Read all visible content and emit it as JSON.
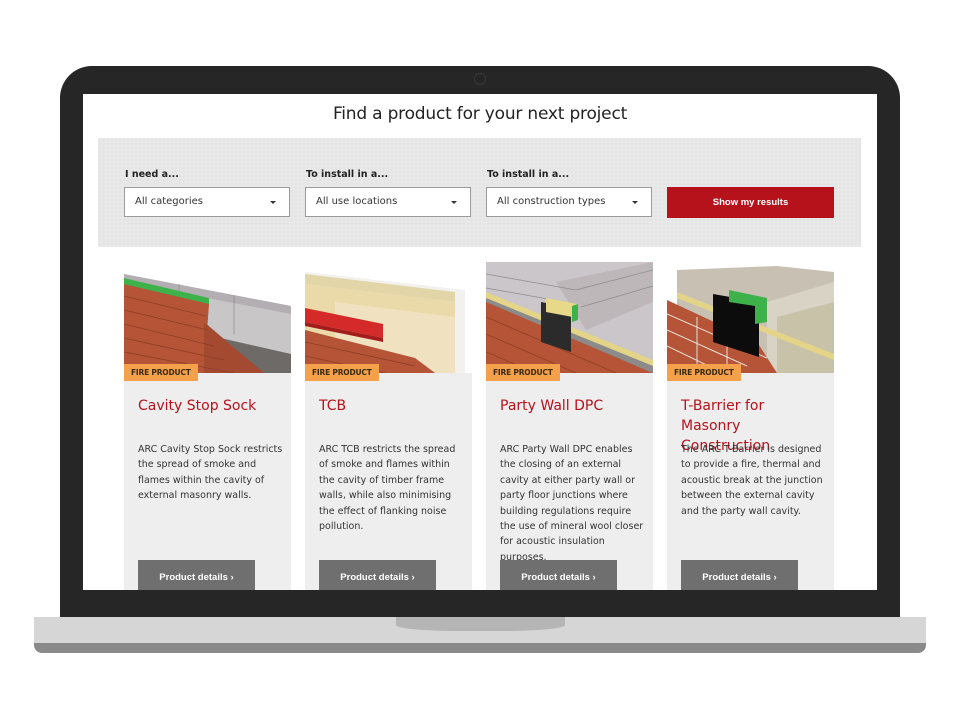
{
  "page": {
    "title": "Find a product for your next project"
  },
  "filters": {
    "category": {
      "label": "I need a...",
      "value": "All categories"
    },
    "location": {
      "label": "To install in a...",
      "value": "All use locations"
    },
    "construction": {
      "label": "To install in a...",
      "value": "All construction types"
    },
    "submit_label": "Show my results"
  },
  "colors": {
    "brand_red": "#b5121b",
    "badge_orange": "#f5a04a",
    "button_grey": "#6f6f6f"
  },
  "products": [
    {
      "badge": "FIRE PRODUCT",
      "title": "Cavity Stop Sock",
      "description": "ARC Cavity Stop Sock restricts the spread of smoke and flames within the cavity of external masonry walls.",
      "button": "Product details ›"
    },
    {
      "badge": "FIRE PRODUCT",
      "title": "TCB",
      "description": "ARC TCB restricts the spread of smoke and flames within the cavity of timber frame walls, while also minimising the effect of flanking noise pollution.",
      "button": "Product details ›"
    },
    {
      "badge": "FIRE PRODUCT",
      "title": "Party Wall DPC",
      "description": "ARC Party Wall DPC enables the closing of an external cavity at either party wall or party floor junctions where building regulations require the use of mineral wool closer for acoustic insulation purposes.",
      "button": "Product details ›"
    },
    {
      "badge": "FIRE PRODUCT",
      "title": "T-Barrier for Masonry Construction",
      "description": "The ARC T-Barrier is designed to provide a fire, thermal and acoustic break at the junction between the external cavity and the party wall cavity.",
      "button": "Product details ›"
    }
  ]
}
